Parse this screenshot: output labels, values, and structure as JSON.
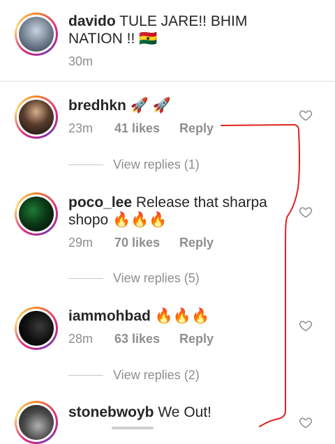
{
  "caption": {
    "username": "davido",
    "text_line1": "TULE JARE!! BHIM",
    "text_line2": "NATION !! 🇬🇭",
    "time": "30m"
  },
  "comments": [
    {
      "username": "bredhkn",
      "text": "🚀 🚀",
      "time": "23m",
      "likes": "41 likes",
      "reply": "Reply",
      "view_replies": "View replies (1)"
    },
    {
      "username": "poco_lee",
      "text_line1": "Release that sharpa",
      "text_line2": "shopo 🔥🔥🔥",
      "time": "29m",
      "likes": "70 likes",
      "reply": "Reply",
      "view_replies": "View replies (5)"
    },
    {
      "username": "iammohbad",
      "text": "🔥🔥🔥",
      "time": "28m",
      "likes": "63 likes",
      "reply": "Reply",
      "view_replies": "View replies (2)"
    },
    {
      "username": "stonebwoyb",
      "text": "We Out!"
    }
  ],
  "colors": {
    "text": "#262626",
    "muted": "#8e8e8e",
    "annotation": "#e0221c"
  }
}
